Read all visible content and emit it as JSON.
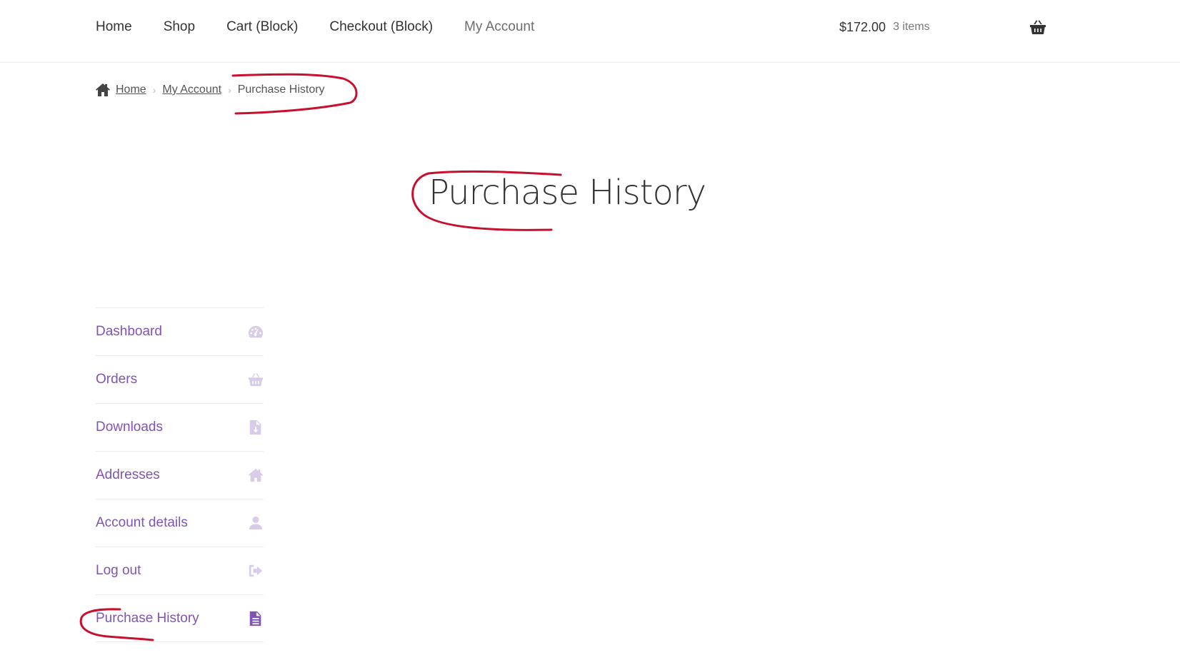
{
  "header": {
    "nav": [
      "Home",
      "Shop",
      "Cart (Block)",
      "Checkout (Block)",
      "My Account"
    ],
    "cart_amount": "$172.00",
    "cart_count": "3 items",
    "cart_icon": "basket-icon"
  },
  "breadcrumb": {
    "home": "Home",
    "parent": "My Account",
    "current": "Purchase History",
    "home_icon": "home-icon"
  },
  "page": {
    "title": "Purchase History"
  },
  "account_nav": [
    {
      "label": "Dashboard",
      "icon": "dashboard-icon"
    },
    {
      "label": "Orders",
      "icon": "basket-icon"
    },
    {
      "label": "Downloads",
      "icon": "file-download-icon"
    },
    {
      "label": "Addresses",
      "icon": "home-icon"
    },
    {
      "label": "Account details",
      "icon": "user-icon"
    },
    {
      "label": "Log out",
      "icon": "sign-out-icon"
    },
    {
      "label": "Purchase History",
      "icon": "document-icon"
    }
  ],
  "colors": {
    "accent": "#7f54b3",
    "icon_muted": "#d9cce9",
    "annotation": "#c8102e"
  }
}
